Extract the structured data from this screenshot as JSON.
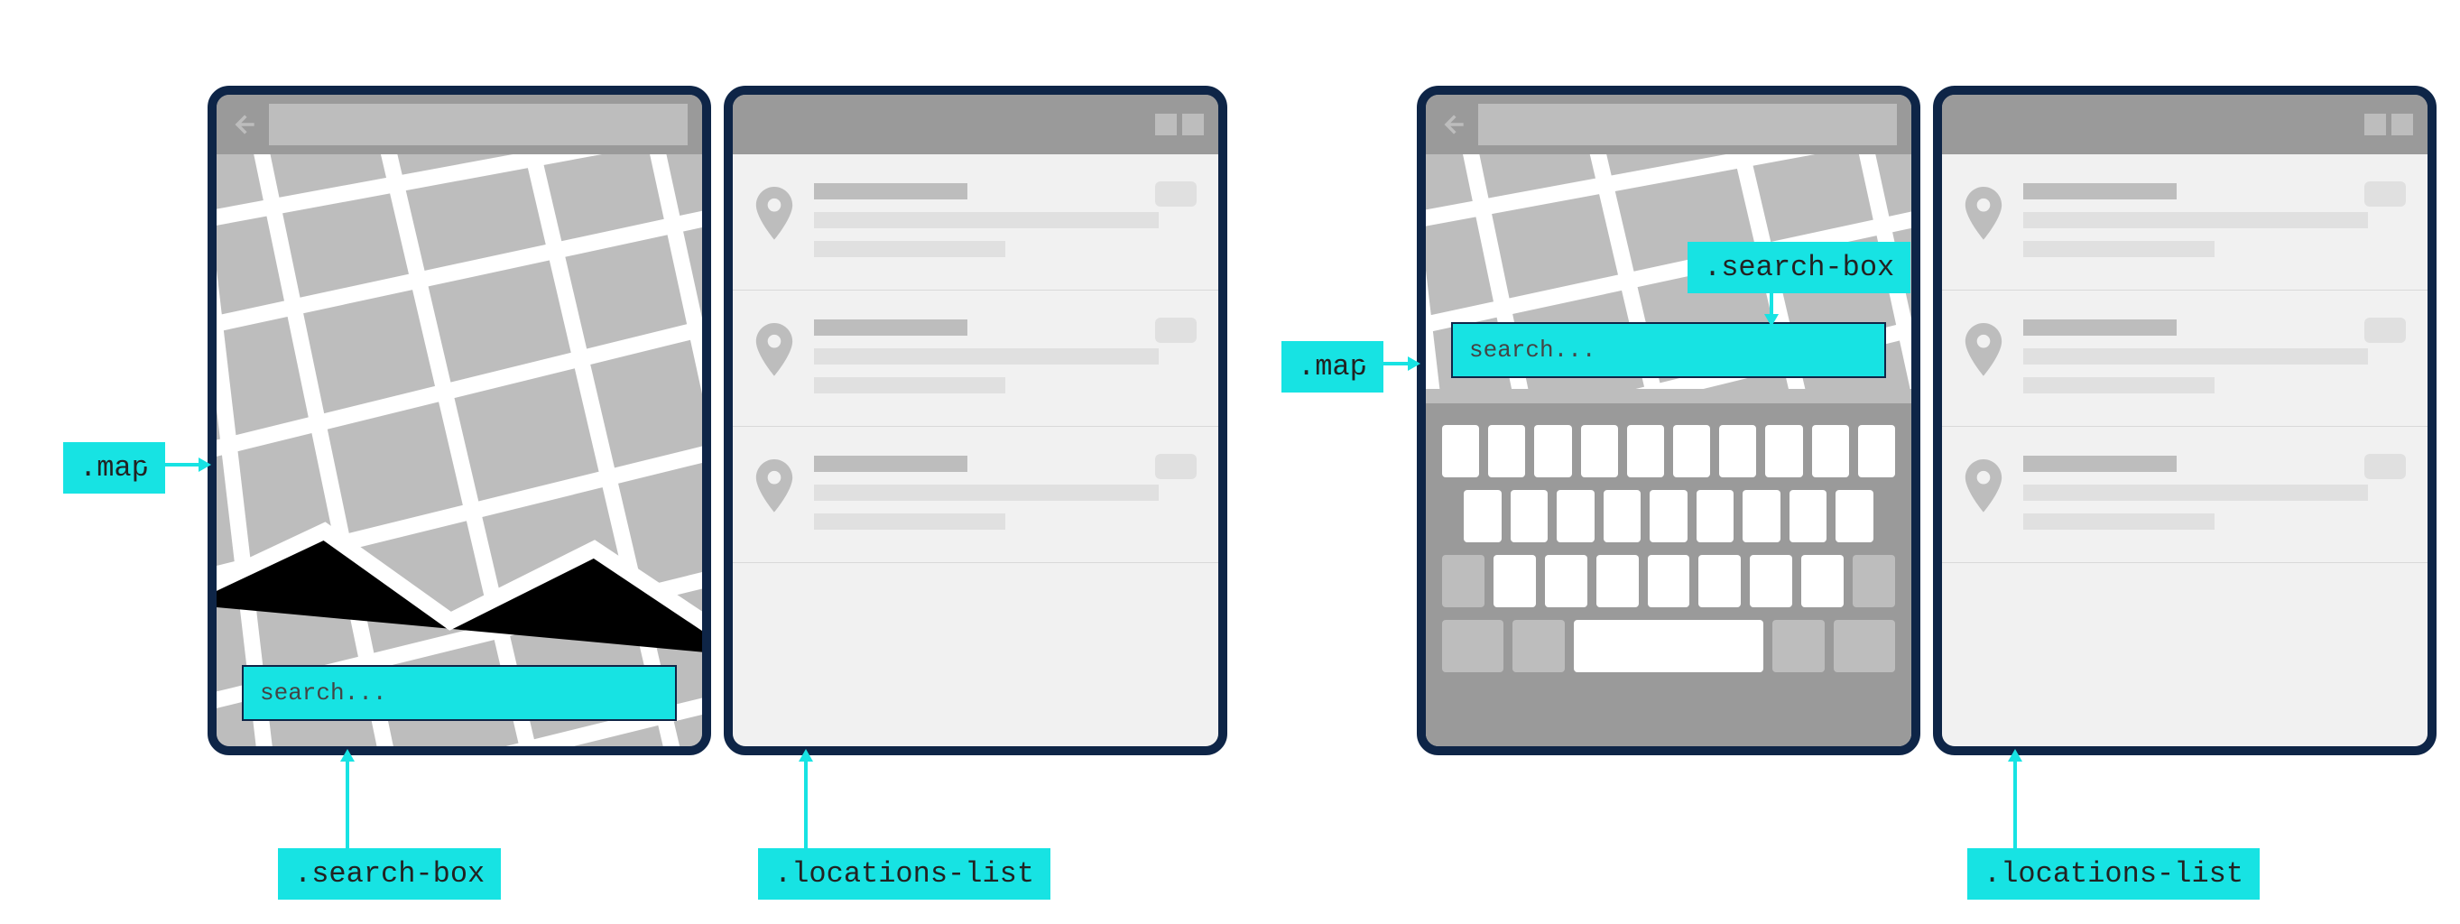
{
  "diagram": {
    "panels_left": {
      "map_panel": {
        "search_box_placeholder": "search...",
        "search_box_position": "bottom"
      },
      "list_panel": {
        "item_count": 3
      },
      "callouts": {
        "map": ".map",
        "search_box": ".search-box",
        "locations_list": ".locations-list"
      }
    },
    "panels_right": {
      "map_panel": {
        "search_box_placeholder": "search...",
        "search_box_position": "raised",
        "keyboard_visible": true
      },
      "list_panel": {
        "item_count": 3
      },
      "callouts": {
        "map": ".map",
        "search_box": ".search-box",
        "locations_list": ".locations-list"
      }
    }
  },
  "colors": {
    "frame": "#0e2547",
    "highlight": "#17e3e3",
    "gray_mid": "#bdbdbd",
    "gray_dark": "#9a9a9a",
    "gray_light": "#f1f1f1"
  }
}
